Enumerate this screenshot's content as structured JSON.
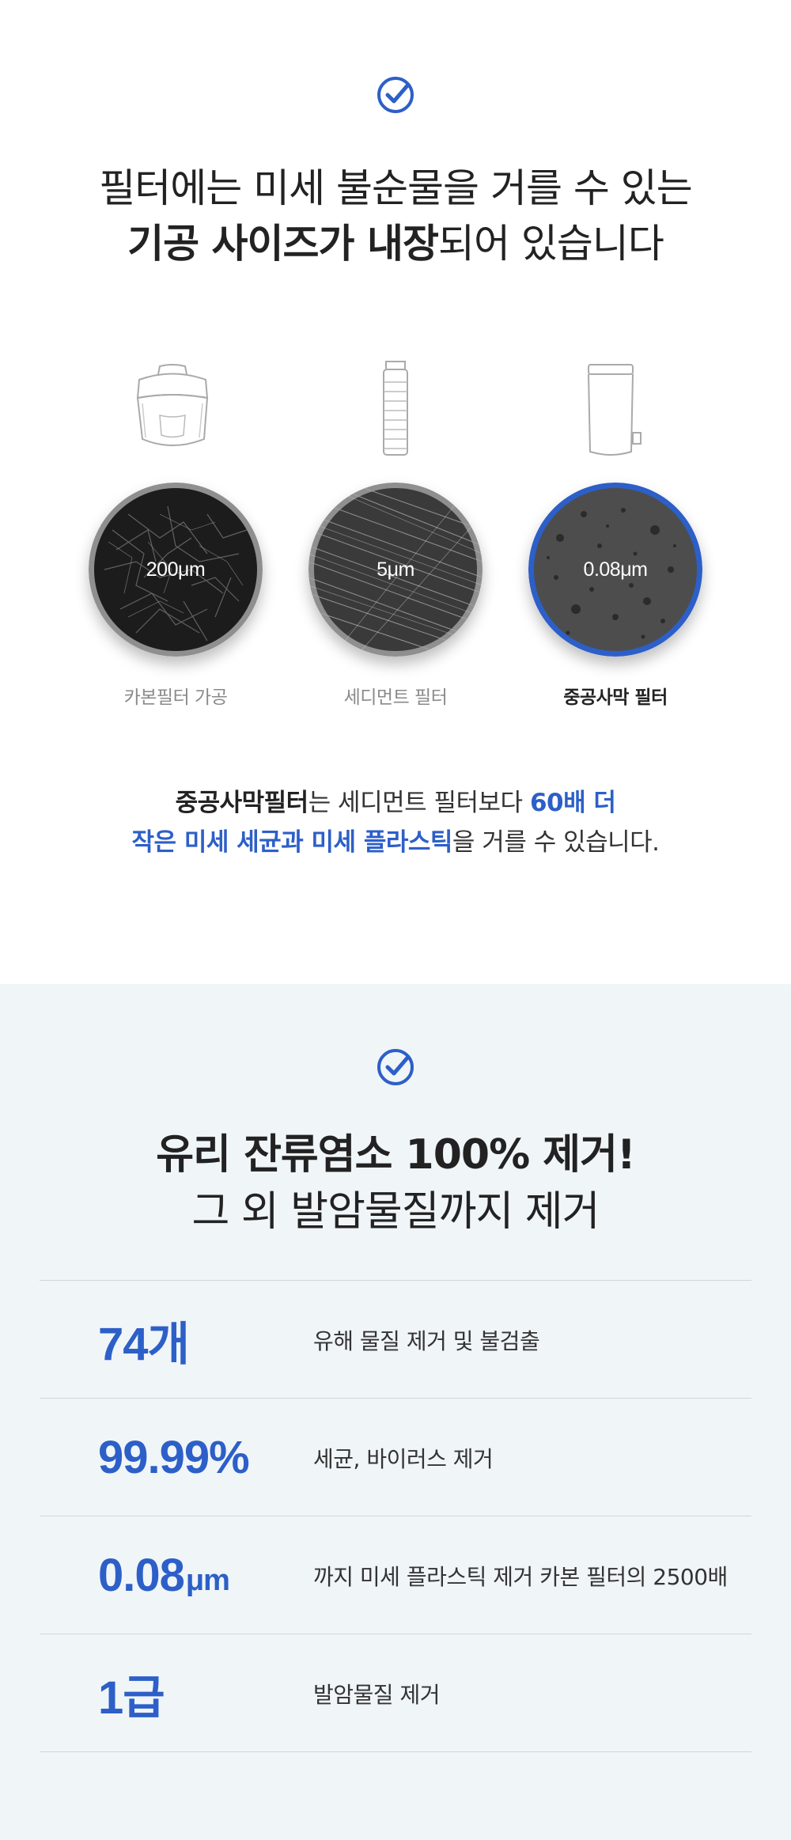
{
  "colors": {
    "accent": "#2d5fc8",
    "section2_bg": "#f0f5f8",
    "text": "#222222",
    "muted": "#8a8a8a"
  },
  "section1": {
    "check_icon": "check-circle-icon",
    "headline_line1": "필터에는 미세 불순물을 거를 수 있는",
    "headline_line2_bold": "기공 사이즈가 내장",
    "headline_line2_rest": "되어 있습니다",
    "filters": [
      {
        "icon": "pitcher-cartridge-icon",
        "size": "200μm",
        "name": "카본필터 가공"
      },
      {
        "icon": "sediment-filter-icon",
        "size": "5μm",
        "name": "세디먼트 필터"
      },
      {
        "icon": "hollow-fiber-filter-icon",
        "size": "0.08μm",
        "name": "중공사막 필터"
      }
    ],
    "compare": {
      "part1_bold": "중공사막필터",
      "part2": "는 세디먼트 필터보다 ",
      "part3_blue": "60배 더",
      "part4_blue": "작은 미세 세균과 미세 플라스틱",
      "part5": "을 거를 수 있습니다."
    }
  },
  "section2": {
    "check_icon": "check-circle-icon",
    "headline_line1": "유리 잔류염소 100% 제거!",
    "headline_line2": "그 외 발암물질까지 제거",
    "stats": [
      {
        "value": "74개",
        "unit": "",
        "desc": "유해 물질 제거 및 불검출"
      },
      {
        "value": "99.99%",
        "unit": "",
        "desc": "세균, 바이러스 제거"
      },
      {
        "value": "0.08",
        "unit": "μm",
        "desc": "까지 미세 플라스틱 제거 카본 필터의 2500배"
      },
      {
        "value": "1급",
        "unit": "",
        "desc": "발암물질 제거"
      }
    ]
  }
}
